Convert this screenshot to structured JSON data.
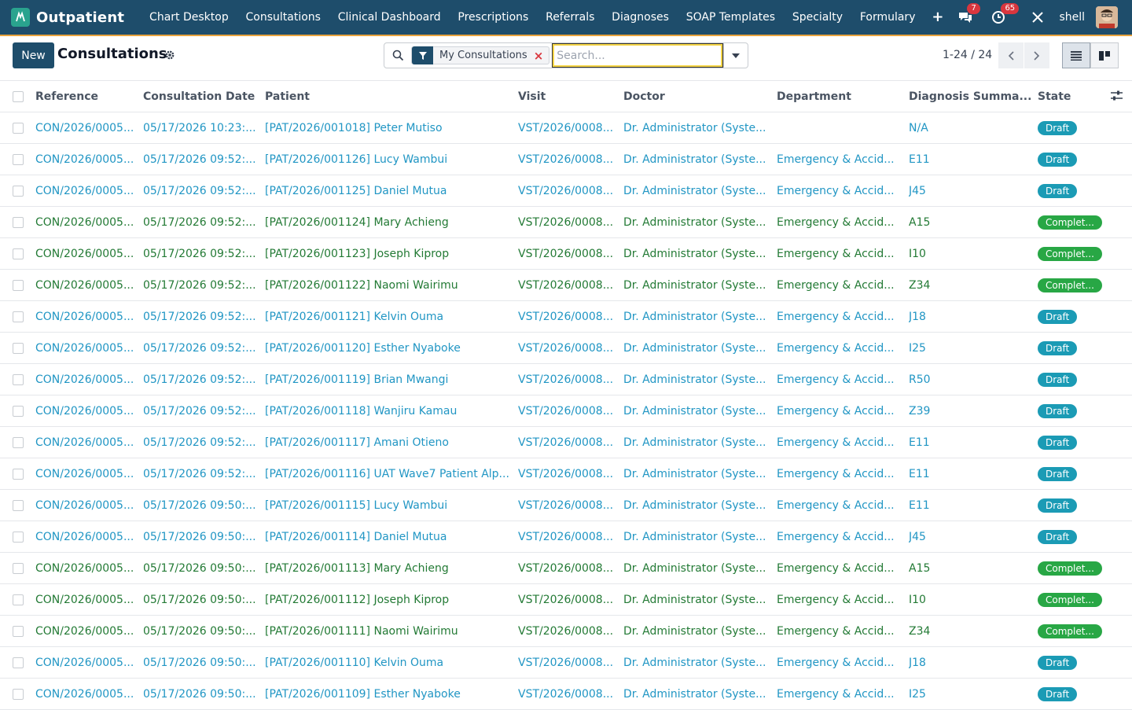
{
  "navbar": {
    "brand": "Outpatient",
    "menu": [
      "Chart Desktop",
      "Consultations",
      "Clinical Dashboard",
      "Prescriptions",
      "Referrals",
      "Diagnoses",
      "SOAP Templates",
      "Specialty",
      "Formulary"
    ],
    "plus_icon": "plus-icon",
    "messages_badge": "7",
    "activities_badge": "65",
    "user_name": "shell"
  },
  "control_panel": {
    "new_label": "New",
    "title": "Consultations",
    "facet_label": "My Consultations",
    "facet_remove": "×",
    "search_placeholder": "Search...",
    "pager": "1-24 / 24"
  },
  "table": {
    "headers": {
      "reference": "Reference",
      "date": "Consultation Date",
      "patient": "Patient",
      "visit": "Visit",
      "doctor": "Doctor",
      "department": "Department",
      "diagnosis": "Diagnosis Summa...",
      "state": "State"
    },
    "rows": [
      {
        "ref": "CON/2026/0005...",
        "date": "05/17/2026 10:23:...",
        "patient": "[PAT/2026/001018] Peter Mutiso",
        "visit": "VST/2026/0008...",
        "doctor": "Dr. Administrator (Syste...",
        "dept": "",
        "diag": "N/A",
        "state": "Draft"
      },
      {
        "ref": "CON/2026/0005...",
        "date": "05/17/2026 09:52:...",
        "patient": "[PAT/2026/001126] Lucy Wambui",
        "visit": "VST/2026/0008...",
        "doctor": "Dr. Administrator (Syste...",
        "dept": "Emergency & Accid...",
        "diag": "E11",
        "state": "Draft"
      },
      {
        "ref": "CON/2026/0005...",
        "date": "05/17/2026 09:52:...",
        "patient": "[PAT/2026/001125] Daniel Mutua",
        "visit": "VST/2026/0008...",
        "doctor": "Dr. Administrator (Syste...",
        "dept": "Emergency & Accid...",
        "diag": "J45",
        "state": "Draft"
      },
      {
        "ref": "CON/2026/0005...",
        "date": "05/17/2026 09:52:...",
        "patient": "[PAT/2026/001124] Mary Achieng",
        "visit": "VST/2026/0008...",
        "doctor": "Dr. Administrator (Syste...",
        "dept": "Emergency & Accid...",
        "diag": "A15",
        "state": "Complet..."
      },
      {
        "ref": "CON/2026/0005...",
        "date": "05/17/2026 09:52:...",
        "patient": "[PAT/2026/001123] Joseph Kiprop",
        "visit": "VST/2026/0008...",
        "doctor": "Dr. Administrator (Syste...",
        "dept": "Emergency & Accid...",
        "diag": "I10",
        "state": "Complet..."
      },
      {
        "ref": "CON/2026/0005...",
        "date": "05/17/2026 09:52:...",
        "patient": "[PAT/2026/001122] Naomi Wairimu",
        "visit": "VST/2026/0008...",
        "doctor": "Dr. Administrator (Syste...",
        "dept": "Emergency & Accid...",
        "diag": "Z34",
        "state": "Complet..."
      },
      {
        "ref": "CON/2026/0005...",
        "date": "05/17/2026 09:52:...",
        "patient": "[PAT/2026/001121] Kelvin Ouma",
        "visit": "VST/2026/0008...",
        "doctor": "Dr. Administrator (Syste...",
        "dept": "Emergency & Accid...",
        "diag": "J18",
        "state": "Draft"
      },
      {
        "ref": "CON/2026/0005...",
        "date": "05/17/2026 09:52:...",
        "patient": "[PAT/2026/001120] Esther Nyaboke",
        "visit": "VST/2026/0008...",
        "doctor": "Dr. Administrator (Syste...",
        "dept": "Emergency & Accid...",
        "diag": "I25",
        "state": "Draft"
      },
      {
        "ref": "CON/2026/0005...",
        "date": "05/17/2026 09:52:...",
        "patient": "[PAT/2026/001119] Brian Mwangi",
        "visit": "VST/2026/0008...",
        "doctor": "Dr. Administrator (Syste...",
        "dept": "Emergency & Accid...",
        "diag": "R50",
        "state": "Draft"
      },
      {
        "ref": "CON/2026/0005...",
        "date": "05/17/2026 09:52:...",
        "patient": "[PAT/2026/001118] Wanjiru Kamau",
        "visit": "VST/2026/0008...",
        "doctor": "Dr. Administrator (Syste...",
        "dept": "Emergency & Accid...",
        "diag": "Z39",
        "state": "Draft"
      },
      {
        "ref": "CON/2026/0005...",
        "date": "05/17/2026 09:52:...",
        "patient": "[PAT/2026/001117] Amani Otieno",
        "visit": "VST/2026/0008...",
        "doctor": "Dr. Administrator (Syste...",
        "dept": "Emergency & Accid...",
        "diag": "E11",
        "state": "Draft"
      },
      {
        "ref": "CON/2026/0005...",
        "date": "05/17/2026 09:52:...",
        "patient": "[PAT/2026/001116] UAT Wave7 Patient Alp...",
        "visit": "VST/2026/0008...",
        "doctor": "Dr. Administrator (Syste...",
        "dept": "Emergency & Accid...",
        "diag": "E11",
        "state": "Draft"
      },
      {
        "ref": "CON/2026/0005...",
        "date": "05/17/2026 09:50:...",
        "patient": "[PAT/2026/001115] Lucy Wambui",
        "visit": "VST/2026/0008...",
        "doctor": "Dr. Administrator (Syste...",
        "dept": "Emergency & Accid...",
        "diag": "E11",
        "state": "Draft"
      },
      {
        "ref": "CON/2026/0005...",
        "date": "05/17/2026 09:50:...",
        "patient": "[PAT/2026/001114] Daniel Mutua",
        "visit": "VST/2026/0008...",
        "doctor": "Dr. Administrator (Syste...",
        "dept": "Emergency & Accid...",
        "diag": "J45",
        "state": "Draft"
      },
      {
        "ref": "CON/2026/0005...",
        "date": "05/17/2026 09:50:...",
        "patient": "[PAT/2026/001113] Mary Achieng",
        "visit": "VST/2026/0008...",
        "doctor": "Dr. Administrator (Syste...",
        "dept": "Emergency & Accid...",
        "diag": "A15",
        "state": "Complet..."
      },
      {
        "ref": "CON/2026/0005...",
        "date": "05/17/2026 09:50:...",
        "patient": "[PAT/2026/001112] Joseph Kiprop",
        "visit": "VST/2026/0008...",
        "doctor": "Dr. Administrator (Syste...",
        "dept": "Emergency & Accid...",
        "diag": "I10",
        "state": "Complet..."
      },
      {
        "ref": "CON/2026/0005...",
        "date": "05/17/2026 09:50:...",
        "patient": "[PAT/2026/001111] Naomi Wairimu",
        "visit": "VST/2026/0008...",
        "doctor": "Dr. Administrator (Syste...",
        "dept": "Emergency & Accid...",
        "diag": "Z34",
        "state": "Complet..."
      },
      {
        "ref": "CON/2026/0005...",
        "date": "05/17/2026 09:50:...",
        "patient": "[PAT/2026/001110] Kelvin Ouma",
        "visit": "VST/2026/0008...",
        "doctor": "Dr. Administrator (Syste...",
        "dept": "Emergency & Accid...",
        "diag": "J18",
        "state": "Draft"
      },
      {
        "ref": "CON/2026/0005...",
        "date": "05/17/2026 09:50:...",
        "patient": "[PAT/2026/001109] Esther Nyaboke",
        "visit": "VST/2026/0008...",
        "doctor": "Dr. Administrator (Syste...",
        "dept": "Emergency & Accid...",
        "diag": "I25",
        "state": "Draft"
      }
    ]
  },
  "colors": {
    "navbar": "#1e4d6b",
    "accent_line": "#e8a33d",
    "link": "#2196c4",
    "completed_text": "#237a35",
    "draft_badge": "#1b9bb5",
    "completed_badge": "#28a745"
  }
}
